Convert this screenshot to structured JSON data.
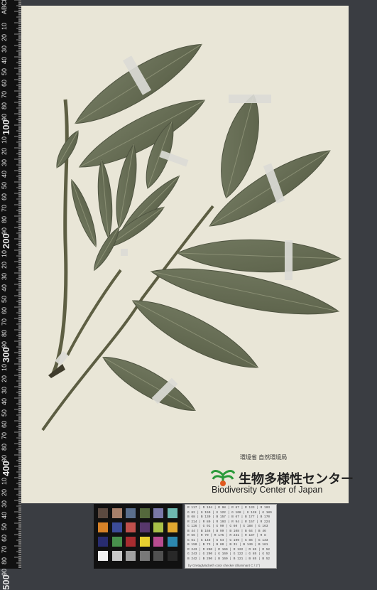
{
  "specimen": {
    "subject": "pressed herbarium specimen, pinnate compound leaves",
    "colors": {
      "background": "#3a3d42",
      "sheet": "#e9e6d7",
      "leaf": "#6e7458",
      "leaf_dark": "#5a6047",
      "stem": "#6b6a4d",
      "tape": "#dcdcd6"
    }
  },
  "ruler": {
    "label": "ABCDE",
    "labels": [
      "10",
      "20",
      "30",
      "40",
      "50",
      "60",
      "70",
      "80",
      "90",
      "100",
      "10",
      "20",
      "30",
      "40",
      "50",
      "60",
      "70",
      "80",
      "90",
      "200",
      "10",
      "20",
      "30",
      "40",
      "50",
      "60",
      "70",
      "80",
      "90",
      "300",
      "10",
      "20",
      "30",
      "40",
      "50",
      "60",
      "70",
      "80",
      "90",
      "400",
      "10",
      "20",
      "30",
      "40",
      "50",
      "60",
      "70",
      "80",
      "90",
      "500"
    ]
  },
  "logo": {
    "org": "環境省 自然環境局",
    "name_jp": "生物多様性センター",
    "name_en": "Biodiversity Center of Japan"
  },
  "color_card": {
    "colors": [
      "#5c4a40",
      "#a8806a",
      "#5a6e8c",
      "#54683c",
      "#7a78a8",
      "#6eb8b0",
      "#d68228",
      "#3c4c98",
      "#c0504c",
      "#58386c",
      "#a8c048",
      "#e0a830",
      "#282c70",
      "#48904c",
      "#a82c30",
      "#e8d030",
      "#b84c90",
      "#2c88b0",
      "#f0f0f0",
      "#c8c8c8",
      "#a0a0a0",
      "#787878",
      "#505050",
      "#282828"
    ]
  },
  "reference_chart": {
    "rows": [
      "R 117 | R 194 | R 98 | R 87 | R 133 | R 103",
      "G 82 | G 150 | G 122 | G 108 | G 128 | G 189",
      "B 68 | B 130 | B 157 | B 67 | B 177 | B 170",
      "R 214 | R 80 | R 193 | R 94 | R 157 | R 224",
      "G 126 | G 91 | G 90 | G 60 | G 188 | G 163",
      "B 44 | B 166 | B 99 | B 108 | B 64 | B 46",
      "R 56 | R 70 | R 175 | R 231 | R 187 | R 8",
      "G 61 | G 148 | G 54 | G 199 | G 86 | G 133",
      "B 150 | B 73 | B 60 | B 31 | B 149 | B 161",
      "R 243 | R 200 | R 160 | R 122 | R 85 | R 52",
      "G 243 | G 200 | G 160 | G 122 | G 85 | G 52",
      "B 242 | B 200 | B 160 | B 121 | B 85 | B 52"
    ],
    "footer": "by GretagMacbeth color checker (Illuminant C / 2°)"
  }
}
